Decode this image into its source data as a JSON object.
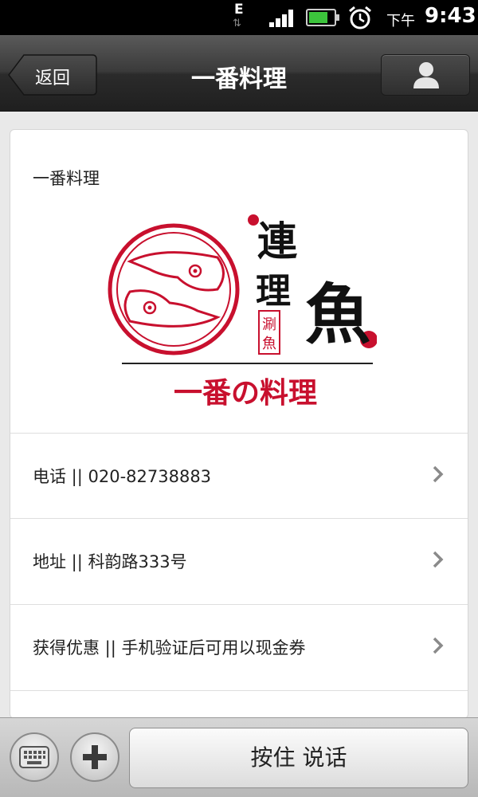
{
  "status_bar": {
    "network": "E",
    "time_prefix": "下午",
    "time": "9:43",
    "battery_level": 0.75
  },
  "header": {
    "back_label": "返回",
    "title": "一番料理"
  },
  "card": {
    "name": "一番料理",
    "logo": {
      "text_main": [
        "連",
        "理",
        "魚"
      ],
      "seal": "涮魚",
      "tagline": "一番の料理",
      "accent_color": "#c8102e"
    },
    "rows": [
      {
        "text": "电话 || 020-82738883"
      },
      {
        "text": "地址 || 科韵路333号"
      },
      {
        "text": "获得优惠 || 手机验证后可用以现金券"
      },
      {
        "text": ""
      }
    ]
  },
  "bottom": {
    "keyboard_icon": "keyboard-icon",
    "plus_icon": "plus-icon",
    "talk_label": "按住 说话"
  }
}
